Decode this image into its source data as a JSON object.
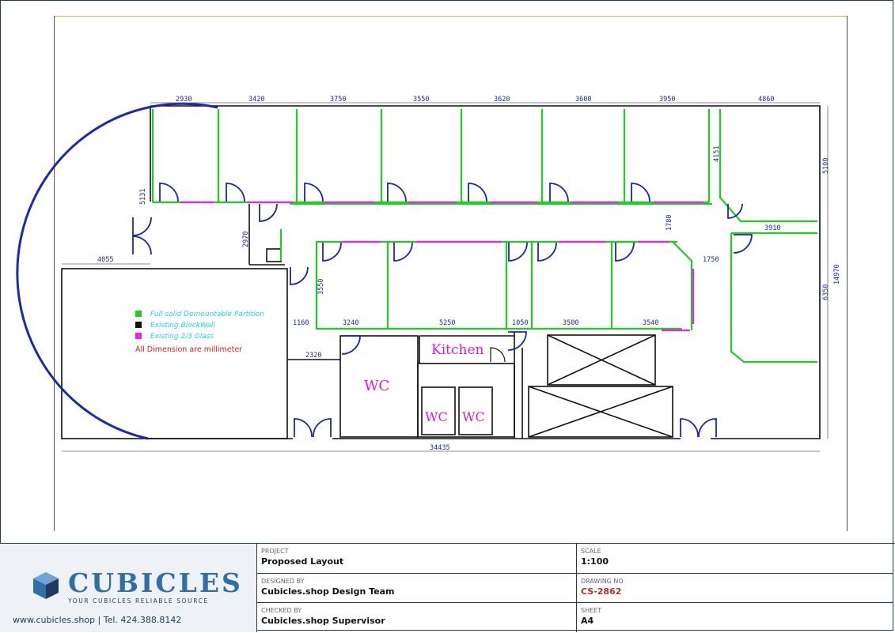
{
  "plan": {
    "dimensions": {
      "top": [
        "2930",
        "3420",
        "3750",
        "3550",
        "3620",
        "3600",
        "3950",
        "4860"
      ],
      "lower": [
        "3240",
        "5250",
        "1050",
        "3500",
        "3540"
      ],
      "left_width": "4055",
      "overall": "34435",
      "corridor_v": "2970",
      "room_h": "3550",
      "left_v": "5131",
      "right_top": "5100",
      "right_total": "14970",
      "right_mid": "6350",
      "east_room": "3910",
      "east_door": "1750",
      "corr_v2": "1780",
      "right_v2": "4151",
      "wc_width": "2320",
      "small_gap": "1160"
    },
    "legend": [
      {
        "color": "#22cc22",
        "label": "Full solid Demountable Partition"
      },
      {
        "color": "#111111",
        "label": "Existing BlockWall"
      },
      {
        "color": "#ee22ee",
        "label": "Existing 2/3 Glass"
      }
    ],
    "note": "All Dimension are millimeter",
    "rooms": {
      "kitchen": "Kitchen",
      "wc_large": "WC",
      "wc_small_1": "WC",
      "wc_small_2": "WC"
    }
  },
  "titleblock": {
    "logo_name": "CUBICLES",
    "logo_tag": "YOUR CUBICLES RELIABLE SOURCE",
    "contact": "www.cubicles.shop  |  Tel. 424.388.8142",
    "project_label": "PROJECT",
    "project_value": "Proposed Layout",
    "designed_label": "DESIGNED BY",
    "designed_value": "Cubicles.shop Design Team",
    "checked_label": "CHECKED BY",
    "checked_value": "Cubicles.shop Supervisor",
    "scale_label": "SCALE",
    "scale_value": "1:100",
    "drawing_label": "DRAWING NO",
    "drawing_value": "CS-2862",
    "sheet_label": "SHEET",
    "sheet_value": "A4"
  },
  "colors": {
    "partition": "#22cc22",
    "glass": "#ee22ee",
    "door": "#1a2aa8",
    "dimension": "#1a2aa8",
    "label_magenta": "#d81ad8",
    "note_red": "#e02020",
    "legend_cyan": "#1ed6e6",
    "brand_blue": "#2e6fa8"
  }
}
